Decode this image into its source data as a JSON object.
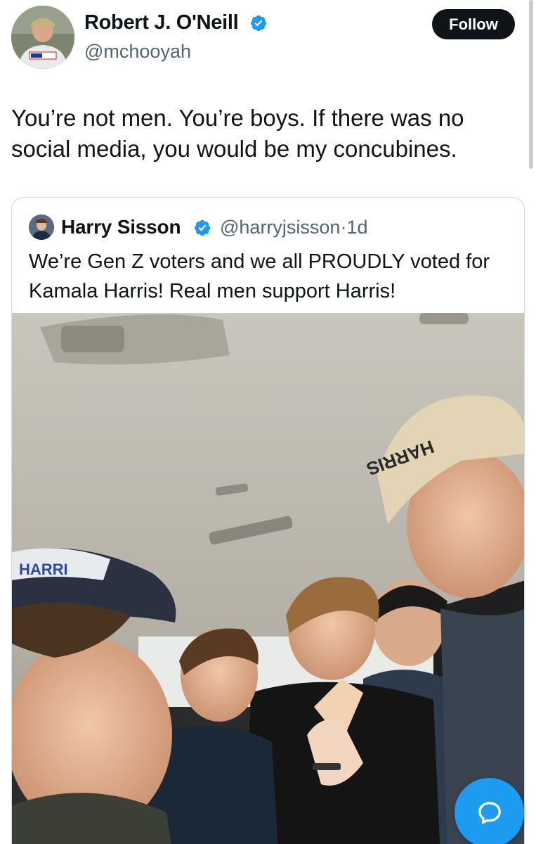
{
  "author": {
    "name": "Robert J. O'Neill",
    "handle": "@mchooyah",
    "verified": true,
    "avatar_icon": "user-avatar"
  },
  "follow_button": {
    "label": "Follow"
  },
  "tweet": {
    "text": "You’re not men. You’re boys. If there was no social media, you would be my concubines."
  },
  "quoted_tweet": {
    "author_name": "Harry Sisson",
    "author_handle": "@harryjsisson",
    "timestamp_separator": "·",
    "timestamp": "1d",
    "verified": true,
    "text": "We’re Gen Z voters and we all PROUDLY voted for Kamala Harris! Real men support Harris!",
    "photo_icon": "group-selfie-photo"
  },
  "reply_fab": {
    "icon": "chat-bubble-icon"
  },
  "colors": {
    "accent": "#1d9bf0",
    "text_primary": "#0f1419",
    "text_secondary": "#536471",
    "button_dark": "#0f1419",
    "border": "#cfd9de"
  }
}
